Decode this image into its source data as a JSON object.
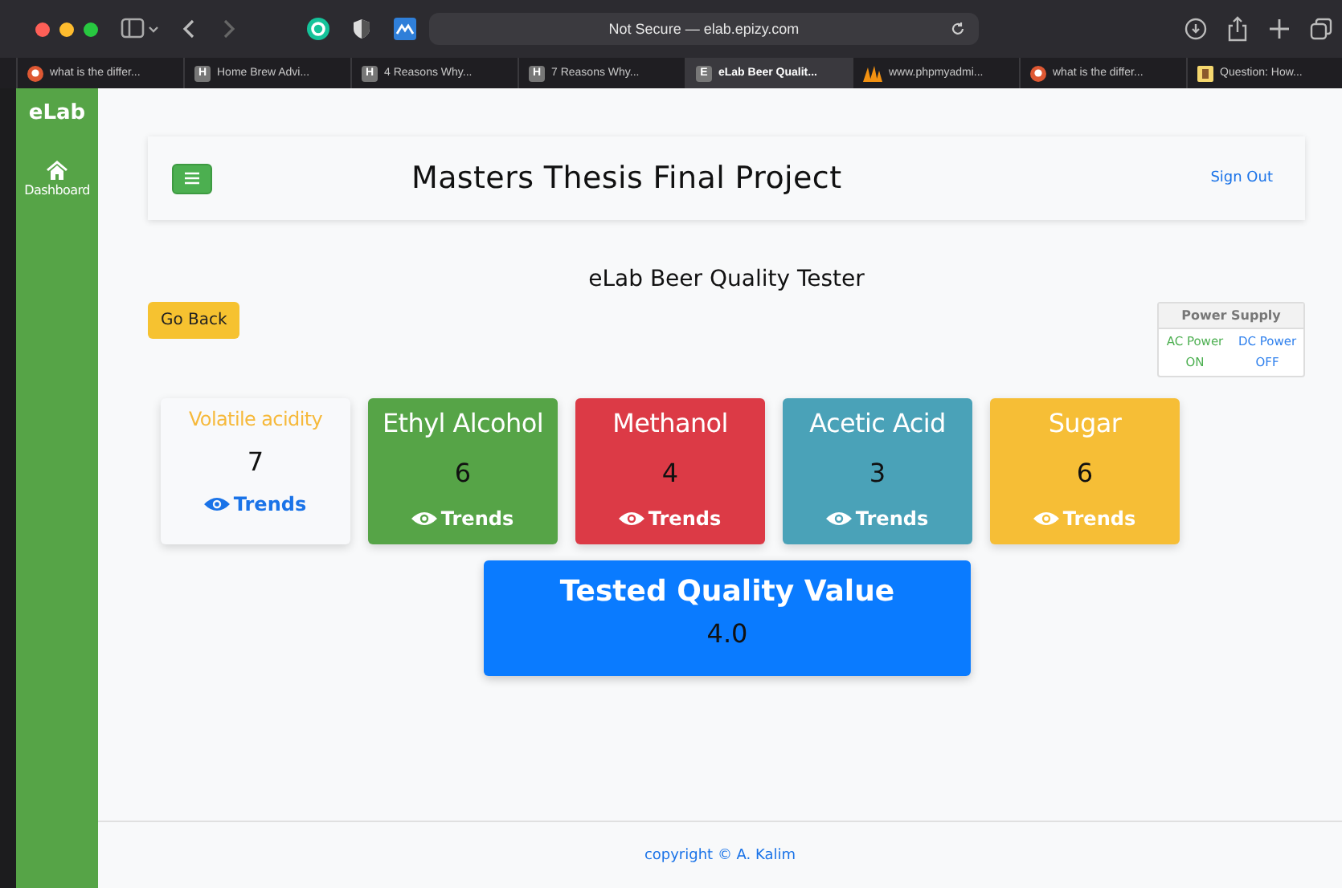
{
  "browser": {
    "address": "Not Secure — elab.epizy.com",
    "tabs": [
      {
        "label": "what is the differ...",
        "kind": "duck",
        "selected": false
      },
      {
        "label": "Home Brew Advi...",
        "kind": "letter",
        "badge": "H",
        "selected": false
      },
      {
        "label": "4 Reasons Why...",
        "kind": "letter",
        "badge": "H",
        "selected": false
      },
      {
        "label": "7 Reasons Why...",
        "kind": "letter",
        "badge": "H",
        "selected": false
      },
      {
        "label": "eLab Beer Qualit...",
        "kind": "letter",
        "badge": "E",
        "selected": true
      },
      {
        "label": "www.phpmyadmi...",
        "kind": "sail",
        "selected": false
      },
      {
        "label": "what is the differ...",
        "kind": "duck",
        "selected": false
      },
      {
        "label": "Question: How...",
        "kind": "note",
        "selected": false
      }
    ]
  },
  "sidebar": {
    "brand": "eLab",
    "items": [
      {
        "label": "Dashboard"
      }
    ]
  },
  "header": {
    "title": "Masters Thesis Final Project",
    "sign_out": "Sign Out"
  },
  "subtitle": "eLab Beer Quality Tester",
  "go_back": "Go Back",
  "power_supply": {
    "title": "Power Supply",
    "columns": [
      {
        "label": "AC Power",
        "state": "ON",
        "color": "#4caf50"
      },
      {
        "label": "DC Power",
        "state": "OFF",
        "color": "#2f80ed"
      }
    ]
  },
  "cards": [
    {
      "kind": "light",
      "title": "Volatile acidity",
      "value": "7",
      "link": "Trends",
      "color": "#f6b93b"
    },
    {
      "kind": "filled",
      "title": "Ethyl Alcohol",
      "value": "6",
      "link": "Trends",
      "color": "#56a447"
    },
    {
      "kind": "filled",
      "title": "Methanol",
      "value": "4",
      "link": "Trends",
      "color": "#dc3a46"
    },
    {
      "kind": "filled",
      "title": "Acetic Acid",
      "value": "3",
      "link": "Trends",
      "color": "#4aa2b8"
    },
    {
      "kind": "filled",
      "title": "Sugar",
      "value": "6",
      "link": "Trends",
      "color": "#f6be36"
    }
  ],
  "quality": {
    "title": "Tested Quality Value",
    "value": "4.0"
  },
  "footer": "copyright © A. Kalim"
}
